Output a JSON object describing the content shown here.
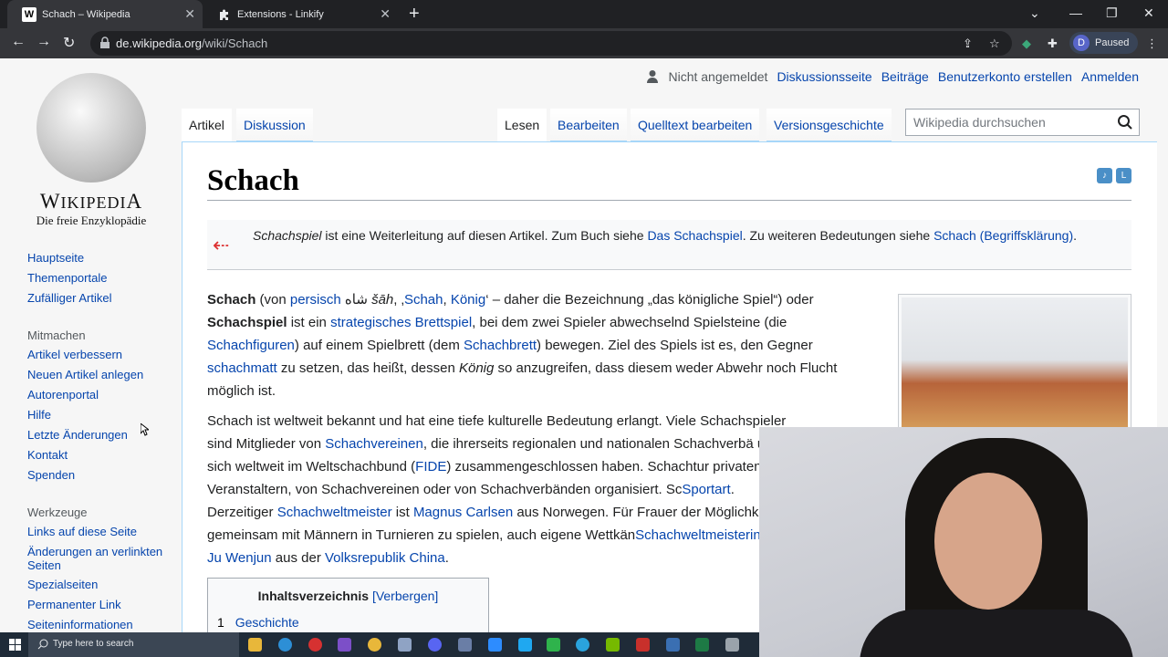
{
  "browser": {
    "tabs": [
      {
        "title": "Schach – Wikipedia",
        "favicon": "W"
      },
      {
        "title": "Extensions - Linkify",
        "favicon": "puzzle-icon"
      }
    ],
    "url_host": "de.wikipedia.org",
    "url_path": "/wiki/Schach",
    "profile_initial": "D",
    "profile_status": "Paused"
  },
  "wiki": {
    "logo_wordmark": "Wikipedia",
    "logo_tagline": "Die freie Enzyklopädie",
    "personal": {
      "not_logged_in": "Nicht angemeldet",
      "talk": "Diskussionsseite",
      "contributions": "Beiträge",
      "create_account": "Benutzerkonto erstellen",
      "login": "Anmelden"
    },
    "tabs_left": [
      "Artikel",
      "Diskussion"
    ],
    "tabs_right": [
      "Lesen",
      "Bearbeiten",
      "Quelltext bearbeiten",
      "Versionsgeschichte"
    ],
    "search_placeholder": "Wikipedia durchsuchen",
    "sidebar": {
      "main": [
        "Hauptseite",
        "Themenportale",
        "Zufälliger Artikel"
      ],
      "mitmachen_heading": "Mitmachen",
      "mitmachen": [
        "Artikel verbessern",
        "Neuen Artikel anlegen",
        "Autorenportal",
        "Hilfe",
        "Letzte Änderungen",
        "Kontakt",
        "Spenden"
      ],
      "werkzeuge_heading": "Werkzeuge",
      "werkzeuge": [
        "Links auf diese Seite",
        "Änderungen an verlinkten Seiten",
        "Spezialseiten",
        "Permanenter Link",
        "Seiteninformationen"
      ]
    },
    "title": "Schach",
    "hatnote": {
      "em": "Schachspiel",
      "t1": " ist eine Weiterleitung auf diesen Artikel. Zum Buch siehe ",
      "link1": "Das Schachspiel",
      "t2": ". Zu weiteren Bedeutungen siehe ",
      "link2": "Schach (Begriffsklärung)",
      "t3": "."
    },
    "p1": {
      "b1": "Schach",
      "t1": " (von ",
      "l1": "persisch",
      "t2": " شاه ",
      "i1": "šāh",
      "t3": ", ‚",
      "l2": "Schah",
      "t4": ", ",
      "l3": "König",
      "t5": "‘ – daher die Bezeichnung „das königliche Spiel“) oder ",
      "b2": "Schachspiel",
      "t6": " ist ein ",
      "l4": "strategisches Brettspiel",
      "t7": ", bei dem zwei Spieler abwechselnd Spielsteine (die ",
      "l5": "Schachfiguren",
      "t8": ") auf einem Spielbrett (dem ",
      "l6": "Schachbrett",
      "t9": ") bewegen. Ziel des Spiels ist es, den Gegner ",
      "l7": "schachmatt",
      "t10": " zu setzen, das heißt, dessen ",
      "i2": "König",
      "t11": " so anzugreifen, dass diesem weder Abwehr noch Flucht möglich ist."
    },
    "p2": {
      "t1": "Schach ist weltweit bekannt und hat eine tiefe kulturelle Bedeutung erlangt. Viele Schachspieler sind Mitglieder von ",
      "l1": "Schachvereinen",
      "t2": ", die ihrerseits regionalen und nationalen Schachverbä",
      "t3": " und sich weltweit im Weltschachbund (",
      "l2": "FIDE",
      "t4": ") zusammengeschlossen haben. Schachtur",
      "t5": " privaten Veranstaltern, von Schachvereinen oder von Schachverbänden organisiert. Sc",
      "l3": "Sportart",
      "t6": ". Derzeitiger ",
      "l4": "Schachweltmeister",
      "t7": " ist ",
      "l5": "Magnus Carlsen",
      "t8": " aus Norwegen. Für Frauer",
      "t9": " der Möglichkeit, gemeinsam mit Männern in Turnieren zu spielen, auch eigene Wettkän",
      "l6": "Schachweltmeisterin",
      "t10": " ist ",
      "l7": "Ju Wenjun",
      "t11": " aus der ",
      "l8": "Volksrepublik China",
      "t12": "."
    },
    "toc": {
      "heading": "Inhaltsverzeichnis",
      "toggle": "[Verbergen]",
      "items": [
        {
          "num": "1",
          "label": "Geschichte"
        }
      ]
    }
  },
  "taskbar": {
    "search_placeholder": "Type here to search"
  }
}
